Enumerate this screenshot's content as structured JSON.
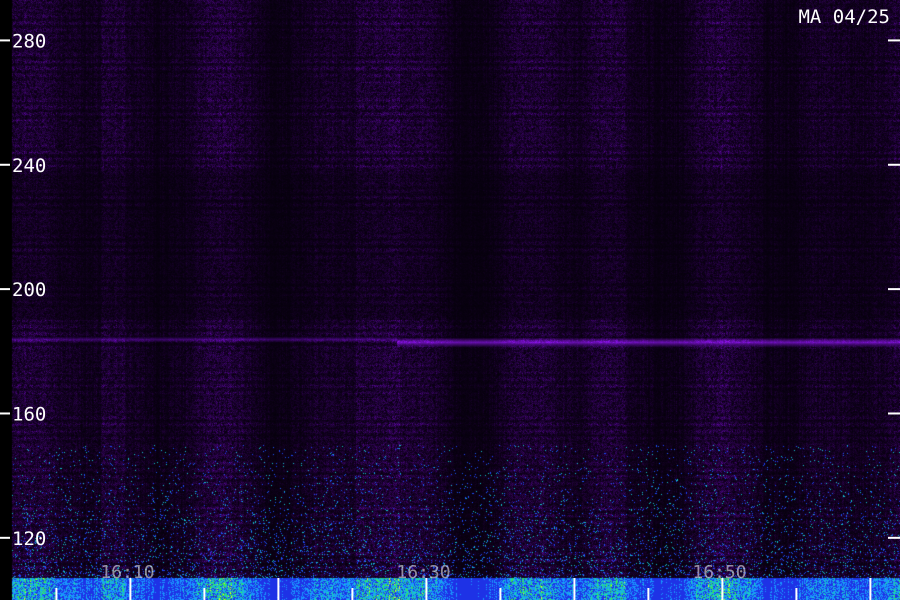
{
  "header": {
    "corner_label": "MA 04/25"
  },
  "chart_data": {
    "type": "heatmap",
    "title": "",
    "ylim": [
      100,
      293
    ],
    "y_ticks": [
      120,
      160,
      200,
      240,
      280
    ],
    "y_tick_labels": [
      "120",
      "160",
      "200",
      "240",
      "280"
    ],
    "x_time_labels": [
      "16:10",
      "16:30",
      "16:50"
    ],
    "x_time_minutes": [
      610,
      630,
      650
    ],
    "x_minor_ticks_minutes": [
      600,
      605,
      610,
      615,
      620,
      625,
      630,
      635,
      640,
      645,
      650,
      655,
      660
    ],
    "xlim_minutes": [
      602,
      662
    ],
    "features": [
      {
        "kind": "horizontal_band",
        "y": 183,
        "from_minute": 628,
        "to_minute": 662,
        "level": "strong"
      },
      {
        "kind": "horizontal_band",
        "y": 184,
        "from_minute": 602,
        "to_minute": 628,
        "level": "weak"
      },
      {
        "kind": "low_frequency_energy",
        "y_range": [
          100,
          107
        ],
        "level": "high"
      },
      {
        "kind": "speckle_noise",
        "y_range": [
          107,
          150
        ],
        "level": "medium"
      }
    ],
    "colors": {
      "background": "#000000",
      "low": "#2b0a45",
      "mid": "#5a14a8",
      "band": "#7a2ad0",
      "high_blue": "#1f3cff",
      "high_cyan": "#1ad0c8",
      "high_green": "#3cf03c",
      "high_yellow": "#d8ff2a"
    }
  }
}
